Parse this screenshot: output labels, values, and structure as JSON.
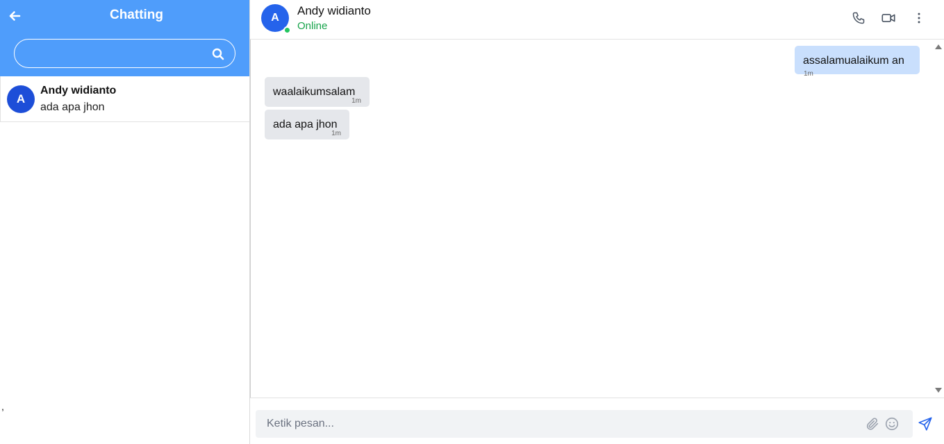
{
  "sidebar": {
    "title": "Chatting",
    "back_icon": "arrow-left-icon",
    "search": {
      "placeholder": "",
      "value": "",
      "icon": "search-icon"
    },
    "contacts": [
      {
        "avatar_initial": "A",
        "name": "Andy widianto",
        "preview": "ada apa jhon"
      }
    ],
    "stray_text": ","
  },
  "chat": {
    "contact": {
      "avatar_initial": "A",
      "name": "Andy widianto",
      "status": "Online"
    },
    "header_icons": [
      "phone-icon",
      "video-icon",
      "more-vertical-icon"
    ],
    "messages": [
      {
        "direction": "out",
        "text": "assalamualaikum an",
        "time": "1m"
      },
      {
        "direction": "in",
        "text": "waalaikumsalam",
        "time": "1m"
      },
      {
        "direction": "in",
        "text": "ada apa jhon",
        "time": "1m"
      }
    ],
    "composer": {
      "placeholder": "Ketik pesan...",
      "value": "",
      "icons": [
        "paperclip-icon",
        "smile-icon",
        "send-icon"
      ]
    }
  },
  "colors": {
    "sidebar_header": "#4f9dfb",
    "avatar": "#1d4ed8",
    "online": "#22c55e",
    "status_text": "#16a34a",
    "bubble_out": "#c9dffd",
    "bubble_in": "#e5e7eb",
    "send": "#2563eb"
  }
}
